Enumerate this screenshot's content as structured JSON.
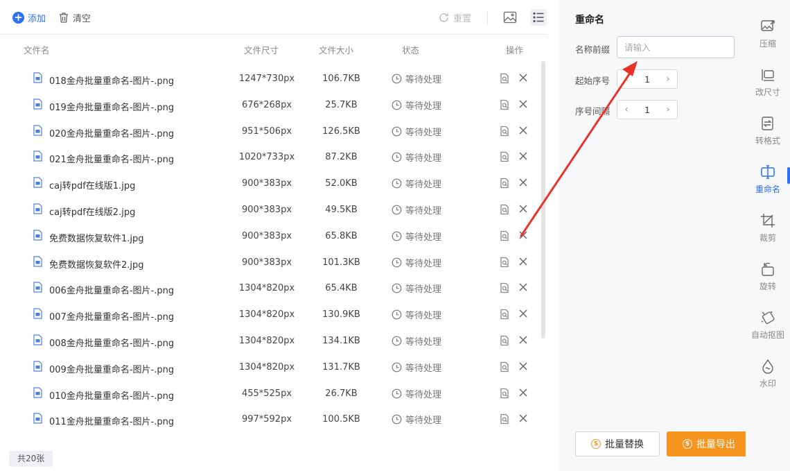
{
  "toolbar": {
    "add_label": "添加",
    "clear_label": "清空",
    "reset_label": "重置"
  },
  "table": {
    "headers": [
      "文件名",
      "文件尺寸",
      "文件大小",
      "状态",
      "操作"
    ],
    "rows": [
      {
        "name": "018金舟批量重命名-图片-.png",
        "size": "1247*730px",
        "bytes": "106.7KB",
        "status": "等待处理"
      },
      {
        "name": "019金舟批量重命名-图片-.png",
        "size": "676*268px",
        "bytes": "25.7KB",
        "status": "等待处理"
      },
      {
        "name": "020金舟批量重命名-图片-.png",
        "size": "951*506px",
        "bytes": "126.5KB",
        "status": "等待处理"
      },
      {
        "name": "021金舟批量重命名-图片-.png",
        "size": "1020*733px",
        "bytes": "87.2KB",
        "status": "等待处理"
      },
      {
        "name": "caj转pdf在线版1.jpg",
        "size": "900*383px",
        "bytes": "52.0KB",
        "status": "等待处理"
      },
      {
        "name": "caj转pdf在线版2.jpg",
        "size": "900*383px",
        "bytes": "49.5KB",
        "status": "等待处理"
      },
      {
        "name": "免费数据恢复软件1.jpg",
        "size": "900*383px",
        "bytes": "65.8KB",
        "status": "等待处理"
      },
      {
        "name": "免费数据恢复软件2.jpg",
        "size": "900*383px",
        "bytes": "101.3KB",
        "status": "等待处理"
      },
      {
        "name": "006金舟批量重命名-图片-.png",
        "size": "1304*820px",
        "bytes": "65.4KB",
        "status": "等待处理"
      },
      {
        "name": "007金舟批量重命名-图片-.png",
        "size": "1304*820px",
        "bytes": "130.9KB",
        "status": "等待处理"
      },
      {
        "name": "008金舟批量重命名-图片-.png",
        "size": "1304*820px",
        "bytes": "134.1KB",
        "status": "等待处理"
      },
      {
        "name": "009金舟批量重命名-图片-.png",
        "size": "1304*820px",
        "bytes": "131.7KB",
        "status": "等待处理"
      },
      {
        "name": "010金舟批量重命名-图片-.png",
        "size": "455*525px",
        "bytes": "26.7KB",
        "status": "等待处理"
      },
      {
        "name": "011金舟批量重命名-图片-.png",
        "size": "997*592px",
        "bytes": "100.5KB",
        "status": "等待处理"
      }
    ]
  },
  "footer": {
    "count_label": "共20张"
  },
  "settings": {
    "title": "重命名",
    "prefix_label": "名称前缀",
    "prefix_placeholder": "请输入",
    "start_label": "起始序号",
    "start_value": "1",
    "interval_label": "序号间隔",
    "interval_value": "1",
    "replace_button": "批量替换",
    "export_button": "批量导出"
  },
  "tools": [
    {
      "id": "compress",
      "label": "压缩",
      "icon": "compress-icon"
    },
    {
      "id": "resize",
      "label": "改尺寸",
      "icon": "resize-icon"
    },
    {
      "id": "convert",
      "label": "转格式",
      "icon": "convert-icon"
    },
    {
      "id": "rename",
      "label": "重命名",
      "icon": "rename-icon",
      "active": true
    },
    {
      "id": "crop",
      "label": "裁剪",
      "icon": "crop-icon"
    },
    {
      "id": "rotate",
      "label": "旋转",
      "icon": "rotate-icon"
    },
    {
      "id": "cutout",
      "label": "自动抠图",
      "icon": "cutout-icon"
    },
    {
      "id": "watermark",
      "label": "水印",
      "icon": "watermark-icon"
    }
  ],
  "colors": {
    "accent": "#2b6ff5",
    "export": "#f7941d",
    "annotation": "#e8322b"
  }
}
